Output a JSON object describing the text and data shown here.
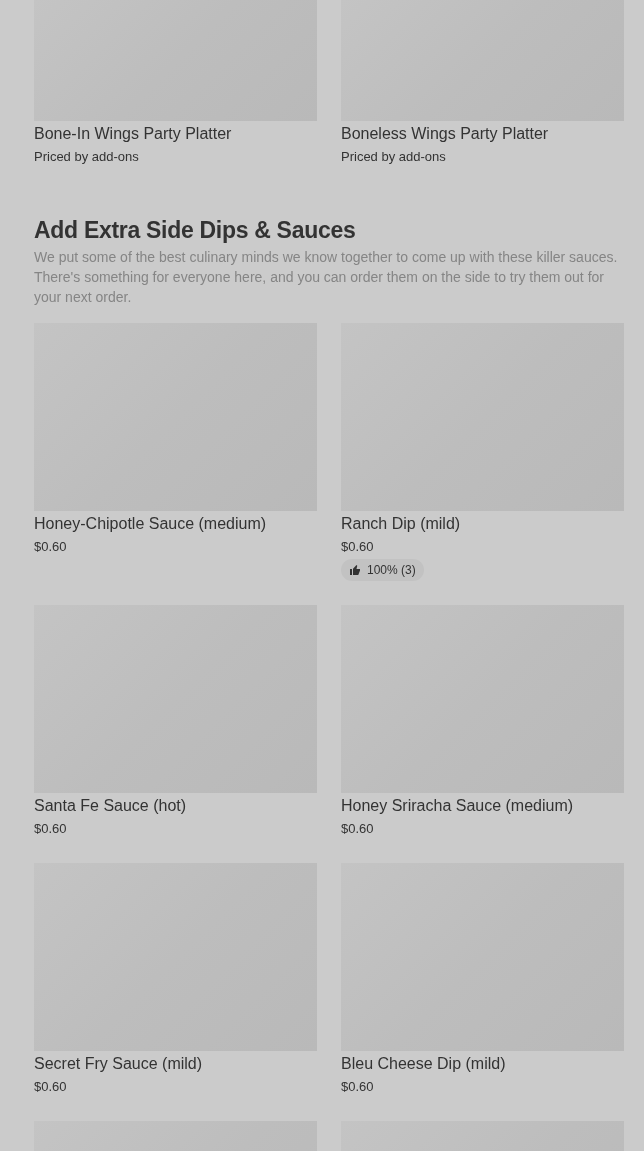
{
  "top_items": [
    {
      "kind": "item",
      "title": "Bone-In Wings Party Platter",
      "price": "Priced by add-ons"
    },
    {
      "kind": "item",
      "title": "Boneless Wings Party Platter",
      "price": "Priced by add-ons"
    }
  ],
  "section": {
    "heading": "Add Extra Side Dips & Sauces",
    "description": "We put some of the best culinary minds we know together to come up with these killer sauces. There's something for everyone here, and you can order them on the side to try them out for your next order.",
    "items": [
      {
        "kind": "item",
        "title": "Honey-Chipotle Sauce (medium)",
        "price": "$0.60"
      },
      {
        "kind": "item",
        "title": "Ranch Dip (mild)",
        "price": "$0.60",
        "rating": "100% (3)"
      },
      {
        "kind": "item",
        "title": "Santa Fe Sauce (hot)",
        "price": "$0.60"
      },
      {
        "kind": "item",
        "title": "Honey Sriracha Sauce (medium)",
        "price": "$0.60"
      },
      {
        "kind": "item",
        "title": "Secret Fry Sauce (mild)",
        "price": "$0.60"
      },
      {
        "kind": "item",
        "title": "Bleu Cheese Dip (mild)",
        "price": "$0.60"
      },
      {
        "kind": "image_only"
      },
      {
        "kind": "image_only"
      }
    ]
  }
}
